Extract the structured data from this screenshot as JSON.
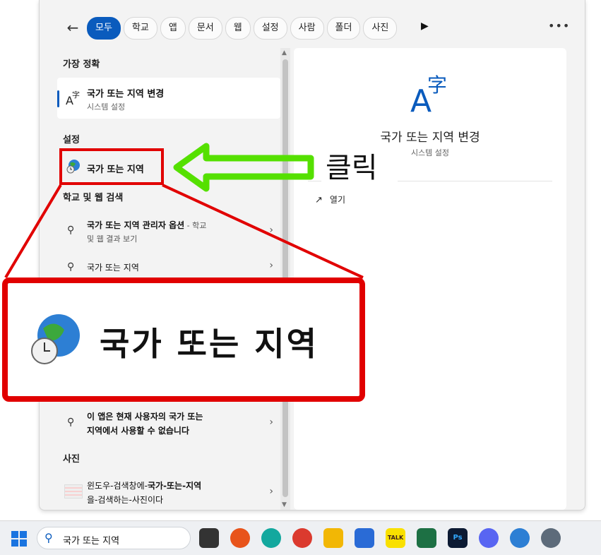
{
  "tabs": [
    "모두",
    "학교",
    "앱",
    "문서",
    "웹",
    "설정",
    "사람",
    "폴더",
    "사진"
  ],
  "sections": {
    "best_match": "가장 정확",
    "settings": "설정",
    "web": "학교 및 웹 검색",
    "photos": "사진"
  },
  "best_item": {
    "title": "국가 또는 지역 변경",
    "subtitle": "시스템 설정"
  },
  "settings_item": {
    "title": "국가 또는 지역"
  },
  "web_items": [
    {
      "bold": "국가 또는 지역 관리자 옵션",
      "normal": " - 학교",
      "line2": "및 웹 결과 보기"
    },
    {
      "text": "국가 또는 지역"
    },
    {
      "line1": "이 앱은 현재 사용자의 국가 또는",
      "line2": "지역에서 사용할 수 없습니다"
    }
  ],
  "photo_item": {
    "line1a": "윈도우-검색창에-",
    "line1b": "국가-또는-지역",
    "line2a": "을",
    "line2b": "-검색하는-사진이다"
  },
  "right_pane": {
    "title": "국가 또는 지역 변경",
    "subtitle": "시스템 설정",
    "open_label": "열기"
  },
  "zoom_label": "국가 또는 지역",
  "annotation": "클릭",
  "taskbar": {
    "search_value": "국가 또는 지역",
    "kakao": "TALK",
    "ps": "Ps"
  },
  "colors": {
    "accent": "#0a5bbd",
    "annotation_red": "#e10000",
    "arrow_green": "#55e000"
  }
}
